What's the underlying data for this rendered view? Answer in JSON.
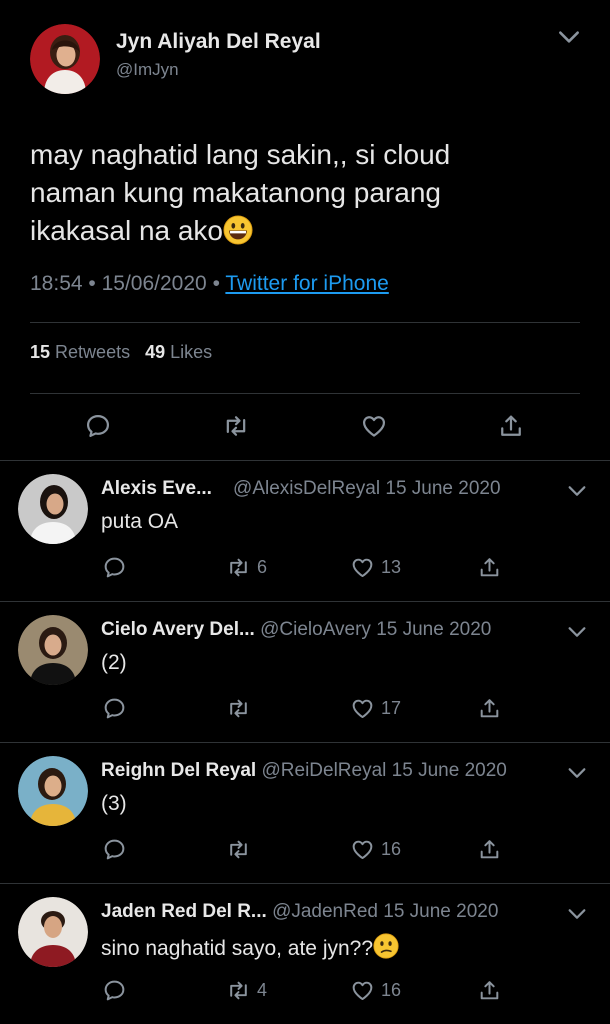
{
  "tweet": {
    "name": "Jyn Aliyah Del Reyal",
    "handle": "@ImJyn",
    "text_line1": "may naghatid lang sakin,, si cloud",
    "text_line2": "naman kung makatanong parang",
    "text_line3": "ikakasal na ako",
    "text_emoji": "grinning-face",
    "time": "18:54",
    "date": "15/06/2020",
    "separator": "•",
    "source": "Twitter for iPhone",
    "retweets_count": "15",
    "retweets_label": "Retweets",
    "likes_count": "49",
    "likes_label": "Likes"
  },
  "replies": [
    {
      "name": "Alexis Eve...",
      "handle": "@AlexisDelReyal",
      "date": "15 June 2020",
      "text": "puta OA",
      "emoji": "",
      "retweets": "6",
      "likes": "13"
    },
    {
      "name": "Cielo Avery Del...",
      "handle": "@CieloAvery",
      "date": "15 June 2020",
      "text": "(2)",
      "emoji": "",
      "retweets": "",
      "likes": "17"
    },
    {
      "name": "Reighn Del Reyal",
      "handle": "@ReiDelReyal",
      "date": "15 June 2020",
      "text": "(3)",
      "emoji": "",
      "retweets": "",
      "likes": "16"
    },
    {
      "name": "Jaden Red Del R...",
      "handle": "@JadenRed",
      "date": "15 June 2020",
      "text": "sino naghatid sayo, ate jyn??",
      "emoji": "confused-face",
      "retweets": "4",
      "likes": "16"
    }
  ],
  "icons": {
    "reply": "reply-icon",
    "retweet": "retweet-icon",
    "like": "heart-icon",
    "share": "share-icon",
    "more": "chevron-down-icon"
  },
  "colors": {
    "background": "#000000",
    "accent": "#1d9bf0",
    "muted": "#7d8590",
    "text": "#e6e6e6",
    "divider": "#2f3336"
  }
}
